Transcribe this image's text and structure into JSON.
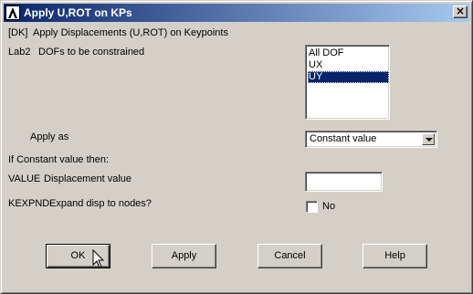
{
  "window": {
    "title": "Apply U,ROT on KPs"
  },
  "header": {
    "command": "[DK]",
    "description": "Apply Displacements (U,ROT) on Keypoints"
  },
  "lab2": {
    "key": "Lab2",
    "label": "DOFs to be constrained",
    "options": [
      "All DOF",
      "UX",
      "UY"
    ],
    "selected": "UY"
  },
  "apply_as": {
    "label": "Apply as",
    "value": "Constant value"
  },
  "if_constant": {
    "label": "If Constant value then:"
  },
  "value_field": {
    "key": "VALUE",
    "label": "Displacement value",
    "value": ""
  },
  "kexpnd": {
    "key": "KEXPND",
    "label": "Expand disp to nodes?",
    "checkbox_label": "No",
    "checked": false
  },
  "buttons": {
    "ok": "OK",
    "apply": "Apply",
    "cancel": "Cancel",
    "help": "Help"
  },
  "icons": {
    "app": "ansys-logo-icon",
    "close": "close-icon",
    "cursor": "mouse-pointer-icon"
  },
  "colors": {
    "titlebar_start": "#0a246a",
    "titlebar_end": "#a6caf0",
    "selection": "#0a246a",
    "face": "#d4d0c8"
  }
}
